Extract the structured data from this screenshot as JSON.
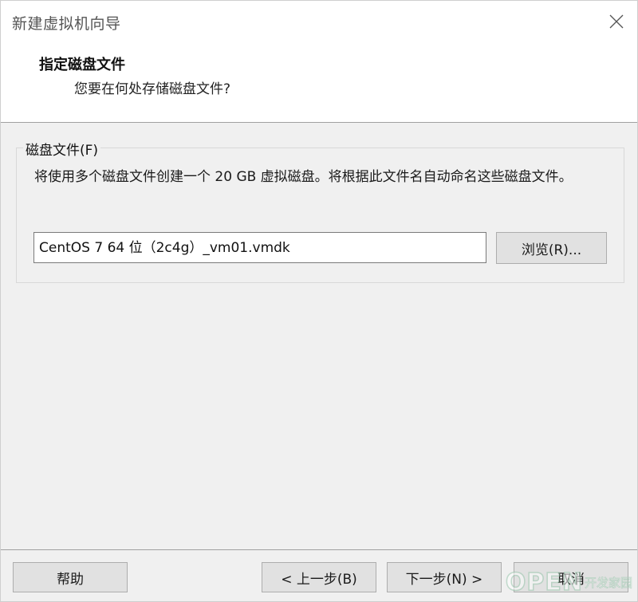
{
  "window": {
    "title": "新建虚拟机向导",
    "close_icon": "close-icon"
  },
  "header": {
    "title": "指定磁盘文件",
    "subtitle": "您要在何处存储磁盘文件?"
  },
  "disk_file_group": {
    "legend": "磁盘文件(F)",
    "description": "将使用多个磁盘文件创建一个 20 GB 虚拟磁盘。将根据此文件名自动命名这些磁盘文件。",
    "filename_value": "CentOS 7 64 位（2c4g）_vm01.vmdk",
    "browse_label": "浏览(R)..."
  },
  "footer": {
    "help_label": "帮助",
    "back_label": "< 上一步(B)",
    "next_label": "下一步(N) >",
    "cancel_label": "取消"
  },
  "watermark": {
    "open_text": "OPEN",
    "cn_text": "开发家园"
  },
  "colors": {
    "dialog_bg": "#f0f0f0",
    "header_bg": "#ffffff",
    "button_bg": "#e1e1e1",
    "watermark": "#9ac7ad"
  }
}
